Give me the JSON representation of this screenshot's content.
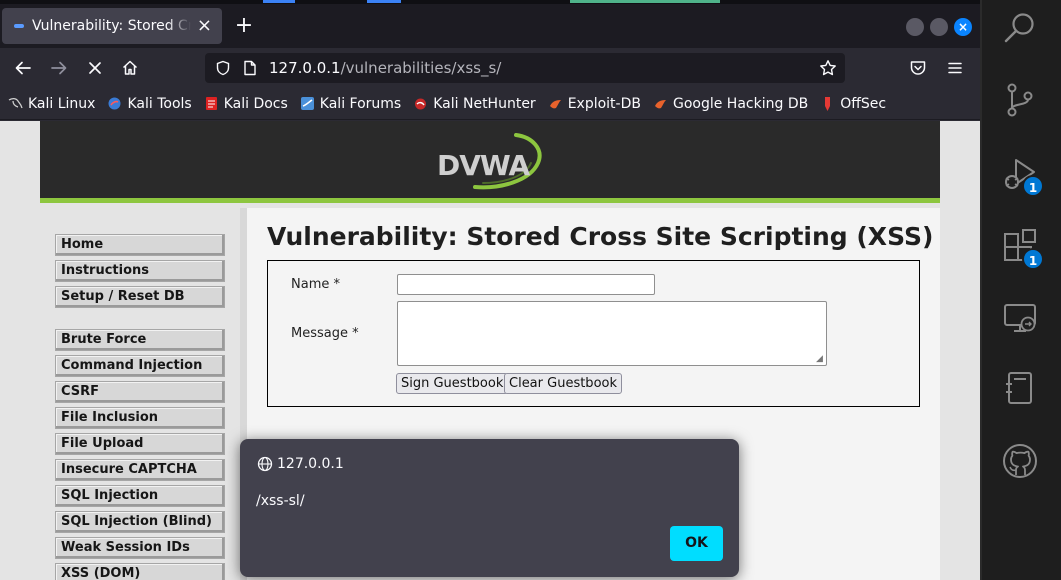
{
  "browser": {
    "tab": {
      "title": "Vulnerability: Stored Cross Site Scripting (XSS) :: Damn Vulnerable Web Application (DVWA)"
    },
    "new_tab_symbol": "+",
    "url": {
      "host": "127.0.0.1",
      "path": "/vulnerabilities/xss_s/"
    },
    "bookmarks": [
      {
        "label": "Kali Linux",
        "icon": "kali-dragon-icon"
      },
      {
        "label": "Kali Tools",
        "icon": "kali-tools-icon"
      },
      {
        "label": "Kali Docs",
        "icon": "kali-docs-icon"
      },
      {
        "label": "Kali Forums",
        "icon": "kali-forums-icon"
      },
      {
        "label": "Kali NetHunter",
        "icon": "kali-nethunter-icon"
      },
      {
        "label": "Exploit-DB",
        "icon": "exploit-db-icon"
      },
      {
        "label": "Google Hacking DB",
        "icon": "ghdb-icon"
      },
      {
        "label": "OffSec",
        "icon": "offsec-icon"
      }
    ]
  },
  "dvwa": {
    "logo_text": "DVWA",
    "menu": {
      "group1": [
        "Home",
        "Instructions",
        "Setup / Reset DB"
      ],
      "group2": [
        "Brute Force",
        "Command Injection",
        "CSRF",
        "File Inclusion",
        "File Upload",
        "Insecure CAPTCHA",
        "SQL Injection",
        "SQL Injection (Blind)",
        "Weak Session IDs",
        "XSS (DOM)"
      ]
    },
    "page_title": "Vulnerability: Stored Cross Site Scripting (XSS)",
    "form": {
      "name_label": "Name *",
      "name_value": "",
      "message_label": "Message *",
      "message_value": "",
      "sign_button": "Sign Guestbook",
      "clear_button": "Clear Guestbook"
    }
  },
  "alert": {
    "origin": "127.0.0.1",
    "message": "/xss-sl/",
    "ok_label": "OK"
  },
  "activity_bar": {
    "items": [
      {
        "icon": "search-icon"
      },
      {
        "icon": "source-control-icon"
      },
      {
        "icon": "run-debug-icon",
        "badge": "1"
      },
      {
        "icon": "extensions-icon",
        "badge": "1"
      },
      {
        "icon": "remote-explorer-icon"
      },
      {
        "icon": "notebook-icon"
      },
      {
        "icon": "github-icon"
      }
    ]
  },
  "colors": {
    "accent": "#0a84ff",
    "dvwa_green": "#8dc63f",
    "alert_ok": "#00ddff",
    "badge": "#0078d4"
  }
}
